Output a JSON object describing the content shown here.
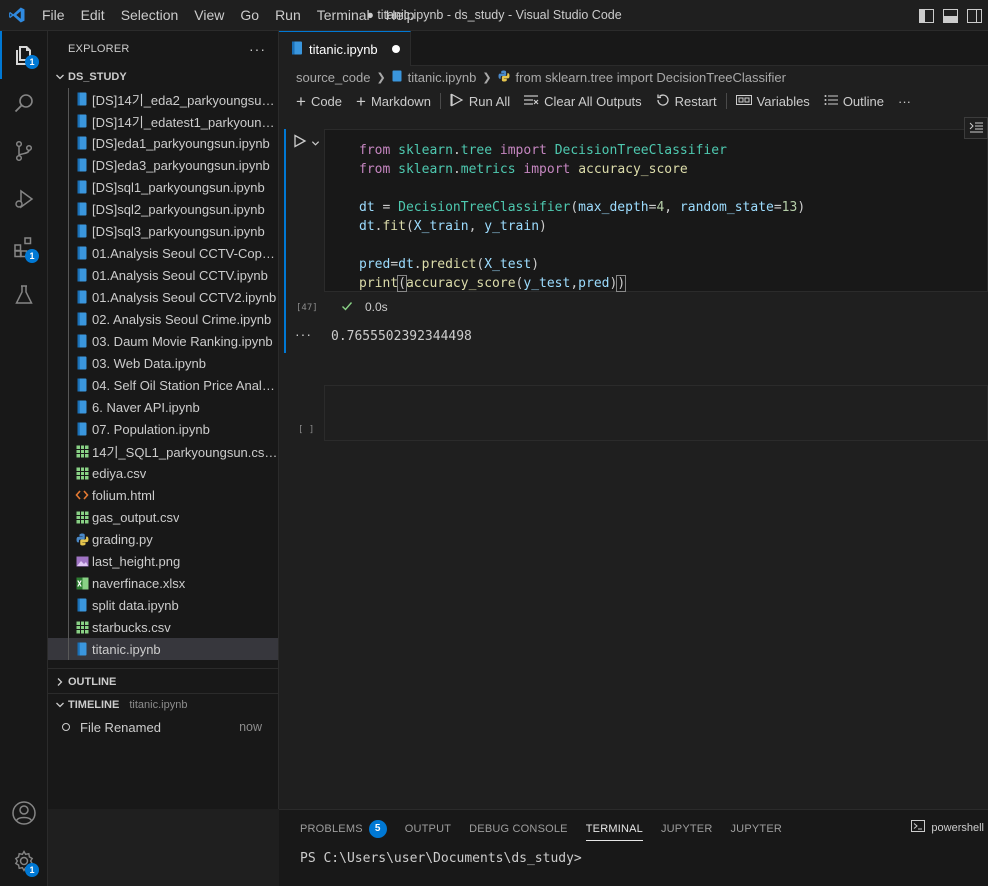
{
  "window": {
    "title": "● titanic.ipynb - ds_study - Visual Studio Code",
    "menu": [
      "File",
      "Edit",
      "Selection",
      "View",
      "Go",
      "Run",
      "Terminal",
      "Help"
    ]
  },
  "activity_bar": {
    "explorer_badge": "1",
    "extensions_badge": "1",
    "settings_badge": "1"
  },
  "sidebar": {
    "header": "EXPLORER",
    "more": "···",
    "folder": "DS_STUDY",
    "files": [
      {
        "name": "[DS]14기_eda2_parkyoungsun.i...",
        "icon": "notebook-icon"
      },
      {
        "name": "[DS]14기_edatest1_parkyoungs...",
        "icon": "notebook-icon"
      },
      {
        "name": "[DS]eda1_parkyoungsun.ipynb",
        "icon": "notebook-icon"
      },
      {
        "name": "[DS]eda3_parkyoungsun.ipynb",
        "icon": "notebook-icon"
      },
      {
        "name": "[DS]sql1_parkyoungsun.ipynb",
        "icon": "notebook-icon"
      },
      {
        "name": "[DS]sql2_parkyoungsun.ipynb",
        "icon": "notebook-icon"
      },
      {
        "name": "[DS]sql3_parkyoungsun.ipynb",
        "icon": "notebook-icon"
      },
      {
        "name": "01.Analysis Seoul CCTV-Copy1....",
        "icon": "notebook-icon"
      },
      {
        "name": "01.Analysis Seoul CCTV.ipynb",
        "icon": "notebook-icon"
      },
      {
        "name": "01.Analysis Seoul CCTV2.ipynb",
        "icon": "notebook-icon"
      },
      {
        "name": "02. Analysis Seoul Crime.ipynb",
        "icon": "notebook-icon"
      },
      {
        "name": "03. Daum Movie Ranking.ipynb",
        "icon": "notebook-icon"
      },
      {
        "name": "03. Web Data.ipynb",
        "icon": "notebook-icon"
      },
      {
        "name": "04. Self Oil Station Price Analys...",
        "icon": "notebook-icon"
      },
      {
        "name": "6. Naver API.ipynb",
        "icon": "notebook-icon"
      },
      {
        "name": "07. Population.ipynb",
        "icon": "notebook-icon"
      },
      {
        "name": "14기_SQL1_parkyoungsun.csv.c...",
        "icon": "csv-icon"
      },
      {
        "name": "ediya.csv",
        "icon": "csv-icon"
      },
      {
        "name": "folium.html",
        "icon": "html-icon"
      },
      {
        "name": "gas_output.csv",
        "icon": "csv-icon"
      },
      {
        "name": "grading.py",
        "icon": "python-icon"
      },
      {
        "name": "last_height.png",
        "icon": "image-icon"
      },
      {
        "name": "naverfinace.xlsx",
        "icon": "excel-icon"
      },
      {
        "name": "split data.ipynb",
        "icon": "notebook-icon"
      },
      {
        "name": "starbucks.csv",
        "icon": "csv-icon"
      },
      {
        "name": "titanic.ipynb",
        "icon": "notebook-icon"
      }
    ],
    "selected_file": "titanic.ipynb",
    "outline_label": "OUTLINE",
    "timeline_label": "TIMELINE",
    "timeline_file": "titanic.ipynb",
    "timeline_item": "File Renamed",
    "timeline_when": "now"
  },
  "editor": {
    "tab_label": "titanic.ipynb",
    "breadcrumbs": [
      "source_code",
      "titanic.ipynb",
      "from sklearn.tree import DecisionTreeClassifier"
    ],
    "toolbar": {
      "code": "Code",
      "markdown": "Markdown",
      "run_all": "Run All",
      "clear_outputs": "Clear All Outputs",
      "restart": "Restart",
      "variables": "Variables",
      "outline": "Outline",
      "more": "···"
    },
    "cell": {
      "exec_count": "[47]",
      "status_time": "0.0s",
      "output": "0.7655502392344498"
    },
    "empty_cell_count": "[ ]"
  },
  "panel": {
    "tabs": [
      "PROBLEMS",
      "OUTPUT",
      "DEBUG CONSOLE",
      "TERMINAL",
      "JUPYTER",
      "JUPYTER"
    ],
    "problems_badge": "5",
    "active_tab": "TERMINAL",
    "shell": "powershell",
    "prompt": "PS C:\\Users\\user\\Documents\\ds_study>"
  },
  "colors": {
    "accent": "#0078d4",
    "background": "#1f1f1f",
    "sidebar": "#181818"
  }
}
